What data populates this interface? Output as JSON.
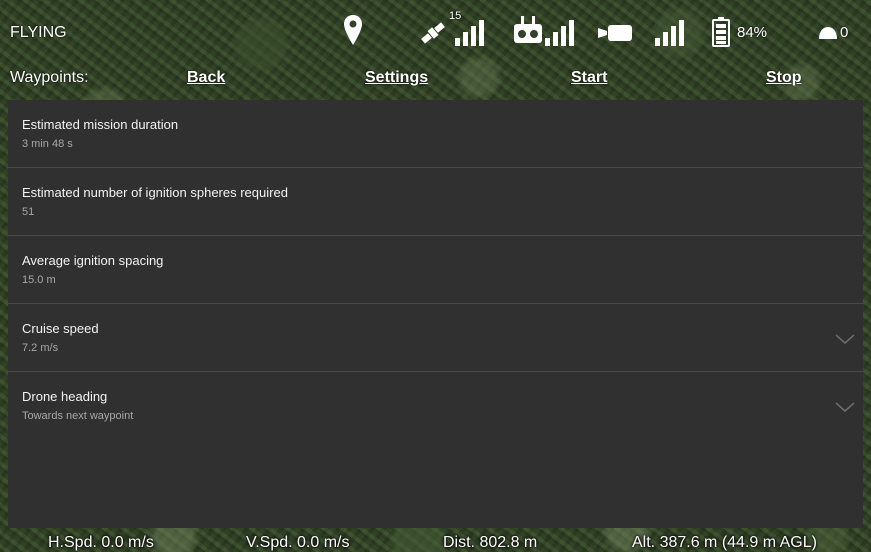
{
  "status": {
    "flight_mode": "FLYING",
    "satellite_count": "15",
    "battery_percent": "84%",
    "spheres_count": "0"
  },
  "nav": {
    "label": "Waypoints:",
    "back": "Back",
    "settings": "Settings",
    "start": "Start",
    "stop": "Stop"
  },
  "settings": {
    "mission_duration": {
      "title": "Estimated mission duration",
      "value": "3 min 48 s"
    },
    "ignition_spheres": {
      "title": "Estimated number of ignition spheres required",
      "value": "51"
    },
    "ignition_spacing": {
      "title": "Average ignition spacing",
      "value": "15.0 m"
    },
    "cruise_speed": {
      "title": "Cruise speed",
      "value": "7.2 m/s"
    },
    "drone_heading": {
      "title": "Drone heading",
      "value": "Towards next waypoint"
    }
  },
  "telemetry": {
    "h_speed": "H.Spd. 0.0 m/s",
    "v_speed": "V.Spd. 0.0 m/s",
    "distance": "Dist. 802.8 m",
    "altitude": "Alt. 387.6 m (44.9 m AGL)"
  },
  "icons": {
    "location": "map-pin-icon",
    "satellite": "satellite-icon",
    "remote": "remote-controller-icon",
    "camera": "video-camera-icon",
    "battery": "battery-icon",
    "sphere": "ignition-sphere-icon"
  }
}
